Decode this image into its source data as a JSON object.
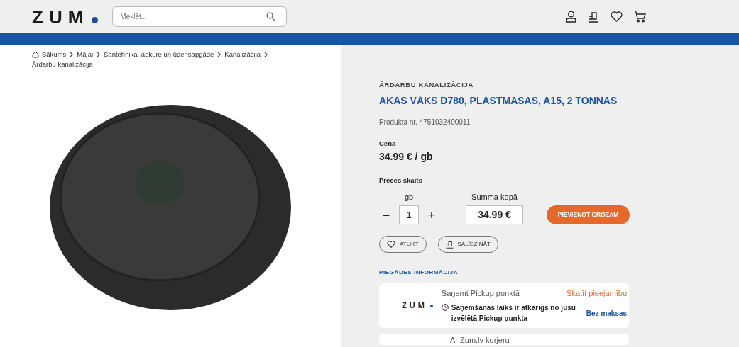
{
  "header": {
    "logo": "ZUM",
    "search": {
      "placeholder": "Meklēt..."
    }
  },
  "breadcrumbs": [
    "Sākums",
    "Mājai",
    "Santehnika, apkure un ūdensapgāde",
    "Kanalizācija",
    "Ārdarbu kanalizācija"
  ],
  "product": {
    "category": "ĀRDARBU KANALIZĀCIJA",
    "title": "AKAS VĀKS D780, PLASTMASAS, A15, 2 TONNAS",
    "number_label": "Produkta nr.",
    "number": "4751032400011",
    "price_label": "Cena",
    "price": "34.99 € / gb",
    "quantity_label": "Preces skaits",
    "unit": "gb",
    "quantity": "1",
    "minus": "−",
    "plus": "+",
    "total_label": "Summa kopā",
    "total": "34.99 €",
    "add_to_cart": "PIEVIENOT GROZAM",
    "wishlist": "ATLIKT",
    "compare": "SALĪDZINĀT"
  },
  "delivery": {
    "heading": "PIEGĀDES INFORMĀCIJA",
    "options": [
      {
        "title": "Saņemt Pickup punktā",
        "logo": "ZUM",
        "link": "Skatīt pieejamību",
        "note": "Saņemšanas laiks ir atkarīgs no jūsu izvēlētā Pickup punkta",
        "price": "Bez maksas"
      },
      {
        "title": "Ar Zum.lv kurjeru"
      }
    ]
  }
}
